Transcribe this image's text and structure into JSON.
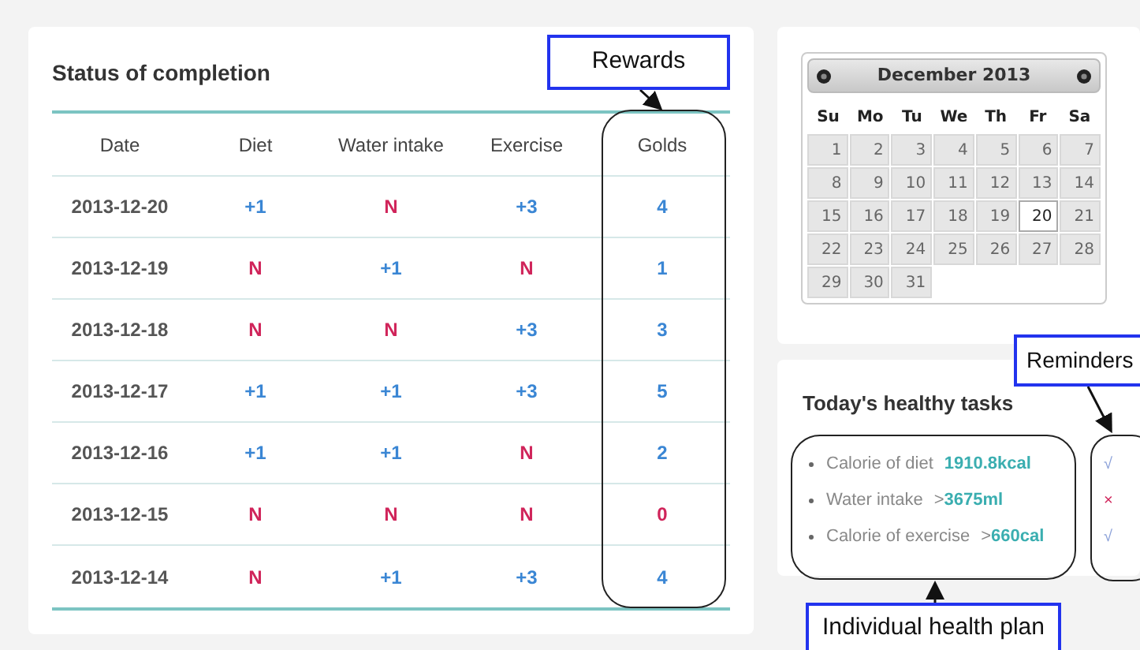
{
  "completion": {
    "title": "Status of completion",
    "columns": [
      "Date",
      "Diet",
      "Water intake",
      "Exercise",
      "Golds"
    ],
    "rows": [
      [
        {
          "kind": "date",
          "text": "2013-12-20"
        },
        {
          "kind": "score",
          "text": "+1",
          "achieved": true
        },
        {
          "kind": "score",
          "text": "N",
          "achieved": false
        },
        {
          "kind": "score",
          "text": "+3",
          "achieved": true
        },
        {
          "kind": "score",
          "text": "4",
          "achieved": true
        }
      ],
      [
        {
          "kind": "date",
          "text": "2013-12-19"
        },
        {
          "kind": "score",
          "text": "N",
          "achieved": false
        },
        {
          "kind": "score",
          "text": "+1",
          "achieved": true
        },
        {
          "kind": "score",
          "text": "N",
          "achieved": false
        },
        {
          "kind": "score",
          "text": "1",
          "achieved": true
        }
      ],
      [
        {
          "kind": "date",
          "text": "2013-12-18"
        },
        {
          "kind": "score",
          "text": "N",
          "achieved": false
        },
        {
          "kind": "score",
          "text": "N",
          "achieved": false
        },
        {
          "kind": "score",
          "text": "+3",
          "achieved": true
        },
        {
          "kind": "score",
          "text": "3",
          "achieved": true
        }
      ],
      [
        {
          "kind": "date",
          "text": "2013-12-17"
        },
        {
          "kind": "score",
          "text": "+1",
          "achieved": true
        },
        {
          "kind": "score",
          "text": "+1",
          "achieved": true
        },
        {
          "kind": "score",
          "text": "+3",
          "achieved": true
        },
        {
          "kind": "score",
          "text": "5",
          "achieved": true
        }
      ],
      [
        {
          "kind": "date",
          "text": "2013-12-16"
        },
        {
          "kind": "score",
          "text": "+1",
          "achieved": true
        },
        {
          "kind": "score",
          "text": "+1",
          "achieved": true
        },
        {
          "kind": "score",
          "text": "N",
          "achieved": false
        },
        {
          "kind": "score",
          "text": "2",
          "achieved": true
        }
      ],
      [
        {
          "kind": "date",
          "text": "2013-12-15"
        },
        {
          "kind": "score",
          "text": "N",
          "achieved": false
        },
        {
          "kind": "score",
          "text": "N",
          "achieved": false
        },
        {
          "kind": "score",
          "text": "N",
          "achieved": false
        },
        {
          "kind": "score",
          "text": "0",
          "achieved": false
        }
      ],
      [
        {
          "kind": "date",
          "text": "2013-12-14"
        },
        {
          "kind": "score",
          "text": "N",
          "achieved": false
        },
        {
          "kind": "score",
          "text": "+1",
          "achieved": true
        },
        {
          "kind": "score",
          "text": "+3",
          "achieved": true
        },
        {
          "kind": "score",
          "text": "4",
          "achieved": true
        }
      ]
    ]
  },
  "calendar": {
    "month": "December 2013",
    "weekdays": [
      "Su",
      "Mo",
      "Tu",
      "We",
      "Th",
      "Fr",
      "Sa"
    ],
    "days": [
      {
        "label": "1",
        "selected": false
      },
      {
        "label": "2",
        "selected": false
      },
      {
        "label": "3",
        "selected": false
      },
      {
        "label": "4",
        "selected": false
      },
      {
        "label": "5",
        "selected": false
      },
      {
        "label": "6",
        "selected": false
      },
      {
        "label": "7",
        "selected": false
      },
      {
        "label": "8",
        "selected": false
      },
      {
        "label": "9",
        "selected": false
      },
      {
        "label": "10",
        "selected": false
      },
      {
        "label": "11",
        "selected": false
      },
      {
        "label": "12",
        "selected": false
      },
      {
        "label": "13",
        "selected": false
      },
      {
        "label": "14",
        "selected": false
      },
      {
        "label": "15",
        "selected": false
      },
      {
        "label": "16",
        "selected": false
      },
      {
        "label": "17",
        "selected": false
      },
      {
        "label": "18",
        "selected": false
      },
      {
        "label": "19",
        "selected": false
      },
      {
        "label": "20",
        "selected": true
      },
      {
        "label": "21",
        "selected": false
      },
      {
        "label": "22",
        "selected": false
      },
      {
        "label": "23",
        "selected": false
      },
      {
        "label": "24",
        "selected": false
      },
      {
        "label": "25",
        "selected": false
      },
      {
        "label": "26",
        "selected": false
      },
      {
        "label": "27",
        "selected": false
      },
      {
        "label": "28",
        "selected": false
      },
      {
        "label": "29",
        "selected": false
      },
      {
        "label": "30",
        "selected": false
      },
      {
        "label": "31",
        "selected": false
      }
    ]
  },
  "tasks": {
    "title": "Today's healthy tasks",
    "items": [
      {
        "label": "Calorie of diet",
        "value": "1910.8kcal",
        "reminder": "√",
        "done": true
      },
      {
        "label": "Water intake",
        "comparator": ">",
        "value": "3675ml",
        "reminder": "×",
        "done": false
      },
      {
        "label": "Calorie of exercise",
        "comparator": ">",
        "value": "660cal",
        "reminder": "√",
        "done": true
      }
    ]
  },
  "annotations": {
    "rewards": "Rewards",
    "reminders": "Reminders",
    "plan": "Individual health plan"
  }
}
